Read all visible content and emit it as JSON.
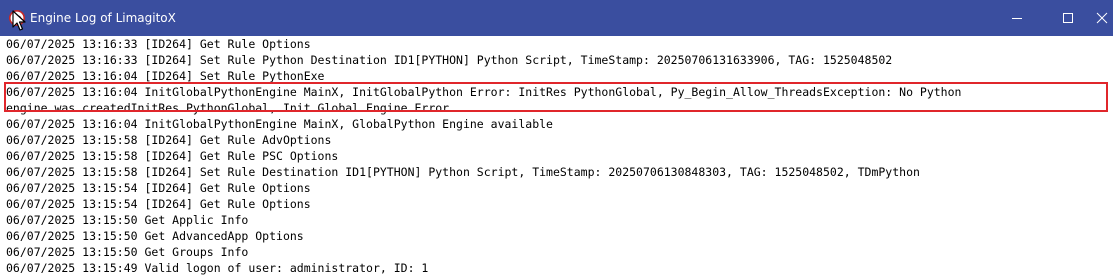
{
  "window": {
    "title": "Engine Log of LimagitoX",
    "icons": {
      "app": "limagito-app-icon",
      "minimize": "minimize-icon",
      "maximize": "maximize-icon",
      "close": "close-icon"
    },
    "colors": {
      "titlebar": "#3a4e9f",
      "highlight": "#e0262b",
      "text": "#000000"
    }
  },
  "log": {
    "lines": [
      "06/07/2025 13:16:33 [ID264] Get Rule Options",
      "06/07/2025 13:16:33 [ID264] Set Rule Python Destination ID1[PYTHON] Python Script, TimeStamp: 20250706131633906, TAG: 1525048502",
      "06/07/2025 13:16:04 [ID264] Set Rule PythonExe",
      "06/07/2025 13:16:04 InitGlobalPythonEngine MainX, InitGlobalPython Error: InitRes PythonGlobal, Py_Begin_Allow_ThreadsException: No Python",
      "engine was createdInitRes PythonGlobal, Init Global Engine Error",
      "06/07/2025 13:16:04 InitGlobalPythonEngine MainX, GlobalPython Engine available",
      "06/07/2025 13:15:58 [ID264] Get Rule AdvOptions",
      "06/07/2025 13:15:58 [ID264] Get Rule PSC Options",
      "06/07/2025 13:15:58 [ID264] Set Rule Destination ID1[PYTHON] Python Script, TimeStamp: 20250706130848303, TAG: 1525048502, TDmPython",
      "06/07/2025 13:15:54 [ID264] Get Rule Options",
      "06/07/2025 13:15:54 [ID264] Get Rule Options",
      "06/07/2025 13:15:50 Get Applic Info",
      "06/07/2025 13:15:50 Get AdvancedApp Options",
      "06/07/2025 13:15:50 Get Groups Info",
      "06/07/2025 13:15:49 Valid logon of user: administrator, ID: 1"
    ],
    "highlighted_entry": {
      "line1": "06/07/2025 13:16:04 InitGlobalPythonEngine MainX, InitGlobalPython Error: InitRes PythonGlobal, Py_Begin_Allow_ThreadsException: No Python",
      "line2": "engine was createdInitRes PythonGlobal, Init Global Engine Error"
    }
  }
}
